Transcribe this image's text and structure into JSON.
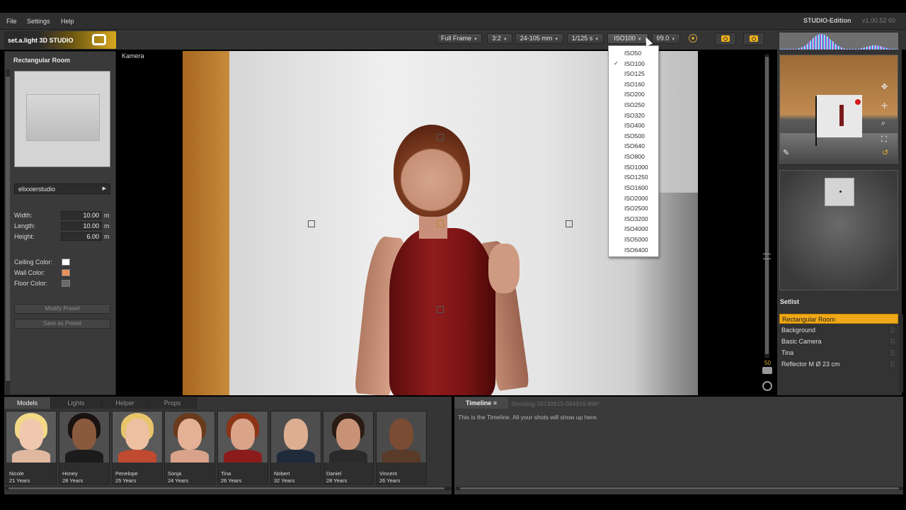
{
  "menu": {
    "file": "File",
    "settings": "Settings",
    "help": "Help"
  },
  "app": {
    "edition": "STUDIO-Edition",
    "version": "v1.00.52  60",
    "logo": "set.a.light 3D STUDIO"
  },
  "toolbar": {
    "frame": "Full Frame",
    "ratio": "3:2",
    "lens": "24-105 mm",
    "shutter": "1/125 s",
    "iso": "ISO100",
    "aperture": "f/9.0"
  },
  "iso_options": [
    "ISO50",
    "ISO100",
    "ISO125",
    "ISO160",
    "ISO200",
    "ISO250",
    "ISO320",
    "ISO400",
    "ISO500",
    "ISO640",
    "ISO800",
    "ISO1000",
    "ISO1250",
    "ISO1600",
    "ISO2000",
    "ISO2500",
    "ISO3200",
    "ISO4000",
    "ISO5000",
    "ISO6400"
  ],
  "iso_selected": "ISO100",
  "left_panel": {
    "title": "Rectangular Room",
    "preset": "elixxierstudio",
    "width_label": "Width:",
    "width_value": "10.00",
    "width_unit": "m",
    "length_label": "Length:",
    "length_value": "10.00",
    "length_unit": "m",
    "height_label": "Height:",
    "height_value": "6.00",
    "height_unit": "m",
    "ceiling_label": "Ceiling Color:",
    "ceiling_color": "#ffffff",
    "wall_label": "Wall Color:",
    "wall_color": "#e8925a",
    "floor_label": "Floor Color:",
    "floor_color": "#6a6a6a",
    "modify_btn": "Modify Preset",
    "save_btn": "Save as Preset"
  },
  "viewport": {
    "label": "Kamera",
    "zoom": "50"
  },
  "setlist": {
    "title": "Setlist",
    "items": [
      "Rectangular Room",
      "Background",
      "Basic Camera",
      "Tina",
      "Reflector M Ø 23 cm"
    ]
  },
  "bottom_tabs": [
    "Models",
    "Lights",
    "Helper",
    "Props"
  ],
  "models": [
    {
      "name": "Nicole",
      "age": "21 Years"
    },
    {
      "name": "Honey",
      "age": "28 Years"
    },
    {
      "name": "Penelope",
      "age": "25 Years"
    },
    {
      "name": "Sonja",
      "age": "24 Years"
    },
    {
      "name": "Tina",
      "age": "26 Years"
    },
    {
      "name": "Nobert",
      "age": "32 Years"
    },
    {
      "name": "Daniel",
      "age": "28 Years"
    },
    {
      "name": "Vincent",
      "age": "26 Years"
    }
  ],
  "timeline": {
    "tab": "Timeline",
    "session": "Shooting-20130815-084916-896*",
    "hint": "This is the Timeline. All your shots will show up here."
  },
  "colors": {
    "accent": "#f0a818"
  }
}
